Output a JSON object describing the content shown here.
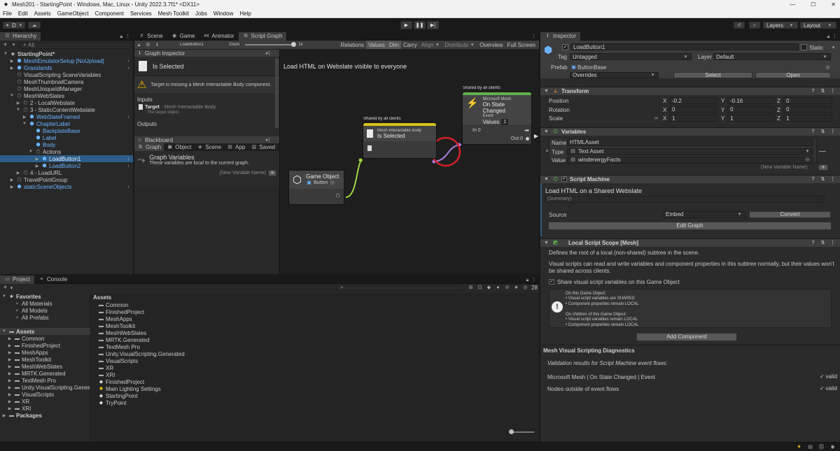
{
  "window": {
    "title": "Mesh201 - StartingPoint - Windows, Mac, Linux - Unity 2022.3.7f1* <DX11>",
    "controls": [
      "—",
      "☐",
      "✕"
    ]
  },
  "menu": [
    "File",
    "Edit",
    "Assets",
    "GameObject",
    "Component",
    "Services",
    "Mesh Toolkit",
    "Jobs",
    "Window",
    "Help"
  ],
  "toolbar": {
    "account": "D",
    "layers": "Layers",
    "layout": "Layout"
  },
  "hierarchy": {
    "tab": "Hierarchy",
    "search_placeholder": "All",
    "items": [
      {
        "label": "StartingPoint*",
        "depth": 0,
        "caret": "▼",
        "blue": false,
        "sel": false,
        "bold": true
      },
      {
        "label": "MeshEmulatorSetup [NoUpload]",
        "depth": 1,
        "caret": "▶",
        "blue": true,
        "sel": false,
        "bold": false
      },
      {
        "label": "Grasslands",
        "depth": 1,
        "caret": "▶",
        "blue": true,
        "sel": false,
        "bold": false
      },
      {
        "label": "VisualScripting SceneVariables",
        "depth": 1,
        "caret": "",
        "blue": false,
        "sel": false,
        "bold": false
      },
      {
        "label": "MeshThumbnailCamera",
        "depth": 1,
        "caret": "",
        "blue": false,
        "sel": false,
        "bold": false
      },
      {
        "label": "MeshUniqueIdManager",
        "depth": 1,
        "caret": "",
        "blue": false,
        "sel": false,
        "bold": false
      },
      {
        "label": "MeshWebSlates",
        "depth": 1,
        "caret": "▼",
        "blue": false,
        "sel": false,
        "bold": false
      },
      {
        "label": "2 - LocalWebslate",
        "depth": 2,
        "caret": "▶",
        "blue": false,
        "sel": false,
        "bold": false
      },
      {
        "label": "3 - StaticContentWebslate",
        "depth": 2,
        "caret": "▼",
        "blue": false,
        "sel": false,
        "bold": false
      },
      {
        "label": "WebSlateFramed",
        "depth": 3,
        "caret": "▶",
        "blue": true,
        "sel": false,
        "bold": false
      },
      {
        "label": "ChapterLabel",
        "depth": 3,
        "caret": "▼",
        "blue": true,
        "sel": false,
        "bold": false
      },
      {
        "label": "BackplateBase",
        "depth": 4,
        "caret": "",
        "blue": true,
        "sel": false,
        "bold": false
      },
      {
        "label": "Label",
        "depth": 4,
        "caret": "",
        "blue": true,
        "sel": false,
        "bold": false
      },
      {
        "label": "Body",
        "depth": 4,
        "caret": "",
        "blue": true,
        "sel": false,
        "bold": false
      },
      {
        "label": "Actions",
        "depth": 4,
        "caret": "▼",
        "blue": false,
        "sel": false,
        "bold": false
      },
      {
        "label": "LoadButton1",
        "depth": 5,
        "caret": "▶",
        "blue": true,
        "sel": true,
        "bold": false
      },
      {
        "label": "LoadButton2",
        "depth": 5,
        "caret": "▶",
        "blue": true,
        "sel": false,
        "bold": false
      },
      {
        "label": "4 - LoadURL",
        "depth": 2,
        "caret": "▶",
        "blue": false,
        "sel": false,
        "bold": false
      },
      {
        "label": "TravelPointGroup",
        "depth": 1,
        "caret": "▶",
        "blue": false,
        "sel": false,
        "bold": false
      },
      {
        "label": "staticSceneObjects",
        "depth": 1,
        "caret": "▶",
        "blue": true,
        "sel": false,
        "bold": false
      }
    ]
  },
  "center_tabs": {
    "scene": "Scene",
    "game": "Game",
    "animator": "Animator",
    "script_graph": "Script Graph"
  },
  "graph_toolbar": {
    "breadcrumb": "LoadButton1",
    "zoom_label": "Zoom",
    "zoom_value": "1x",
    "toggles": [
      "Relations",
      "Values",
      "Dim",
      "Carry",
      "Align",
      "Distribute",
      "Overview",
      "Full Screen"
    ]
  },
  "graph_inspector": {
    "header": "Graph Inspector",
    "title": "Is Selected",
    "warning": "Target is missing a Mesh Interactable Body component.",
    "inputs_label": "Inputs",
    "input_name": "Target",
    "input_type": ": Mesh Interactable Body",
    "input_desc": "The target object.",
    "outputs_label": "Outputs"
  },
  "blackboard": {
    "header": "Blackboard",
    "tabs": [
      "Graph",
      "Object",
      "Scene",
      "App",
      "Saved"
    ],
    "title": "Graph Variables",
    "desc": "These variables are local to the current graph.",
    "new_var": "(New Variable Name)"
  },
  "canvas": {
    "title": "Load HTML on Webslate visible to everyone",
    "node_go": {
      "title": "Game Object",
      "value": "Button"
    },
    "node_body": {
      "shared": "Shared by all clients",
      "line1": "Mesh Interactable Body",
      "line2": "Is Selected"
    },
    "node_event": {
      "shared": "Shared by all clients",
      "line1": "Microsoft Mesh",
      "line2": "On State Changed",
      "line3": "Event",
      "values_label": "Values",
      "values_count": "1",
      "in": "In 0",
      "out": "Out 0"
    }
  },
  "inspector": {
    "tab": "Inspector",
    "object_name": "LoadButton1",
    "static_label": "Static",
    "tag_label": "Tag",
    "tag_value": "Untagged",
    "layer_label": "Layer",
    "layer_value": "Default",
    "prefab_label": "Prefab",
    "prefab_value": "ButtonBase",
    "overrides": "Overrides",
    "select": "Select",
    "open": "Open",
    "transform": {
      "title": "Transform",
      "rows": [
        {
          "label": "Position",
          "x": "-0.2",
          "y": "-0.16",
          "z": "0"
        },
        {
          "label": "Rotation",
          "x": "0",
          "y": "0",
          "z": "0"
        },
        {
          "label": "Scale",
          "x": "1",
          "y": "1",
          "z": "1"
        }
      ]
    },
    "variables": {
      "title": "Variables",
      "name_label": "Name",
      "name_value": "HTMLAsset",
      "type_label": "Type",
      "type_value": "Text Asset",
      "value_label": "Value",
      "value_value": "windenergyFacts",
      "new_var": "(New Variable Name)"
    },
    "script_machine": {
      "title": "Script Machine",
      "name": "Load HTML on a Shared Webslate",
      "summary": "(Summary)",
      "source_label": "Source",
      "source_value": "Embed",
      "convert": "Convert",
      "edit_graph": "Edit Graph"
    },
    "local_scope": {
      "title": "Local Script Scope [Mesh]",
      "desc1": "Defines the root of a local (non-shared) subtree in the scene.",
      "desc2": "Visual scripts can read and write variables and component properties in this subtree normally, but their values won't be shared across clients.",
      "share_label": "Share visual script variables on this Game Object",
      "info": [
        "On this Game Object:",
        "• Visual script variables are SHARED",
        "• Component properties remain LOCAL",
        "",
        "On children of this Game Object:",
        "• Visual script variables remain LOCAL",
        "• Component properties remain LOCAL"
      ]
    },
    "add_component": "Add Component",
    "diagnostics": {
      "title": "Mesh Visual Scripting Diagnostics",
      "subtitle": "Validation results for Script Machine event flows:",
      "rows": [
        {
          "label": "Microsoft Mesh | On State Changed | Event",
          "status": "valid"
        },
        {
          "label": "Nodes outside of event flows",
          "status": "valid"
        }
      ]
    }
  },
  "project": {
    "tabs": {
      "project": "Project",
      "console": "Console"
    },
    "count": "28",
    "favorites": {
      "label": "Favorites",
      "items": [
        "All Materials",
        "All Models",
        "All Prefabs"
      ]
    },
    "assets_tree": {
      "label": "Assets",
      "items": [
        "Common",
        "FinishedProject",
        "MeshApps",
        "MeshToolkit",
        "MeshWebSlates",
        "MRTK.Generated",
        "TextMesh Pro",
        "Unity.VisualScripting.Genera",
        "VisualScripts",
        "XR",
        "XRI"
      ]
    },
    "packages": "Packages",
    "assets_header": "Assets",
    "folders": [
      "Common",
      "FinishedProject",
      "MeshApps",
      "MeshToolkit",
      "MeshWebSlates",
      "MRTK.Generated",
      "TextMesh Pro",
      "Unity.VisualScripting.Generated",
      "VisualScripts",
      "XR",
      "XRI"
    ],
    "files": [
      {
        "label": "FinishedProject",
        "icon": "unity"
      },
      {
        "label": "Main Lighting Settings",
        "icon": "light"
      },
      {
        "label": "StartingPoint",
        "icon": "unity"
      },
      {
        "label": "TryPoint",
        "icon": "unity"
      }
    ]
  },
  "colors": {
    "accent": "#2c5d87",
    "yellow_bar": "#d6c41a",
    "green_bar": "#5fb24a",
    "red_circle": "#d4212a",
    "edge_green": "#9ed640",
    "edge_purple": "#b07ee0"
  }
}
